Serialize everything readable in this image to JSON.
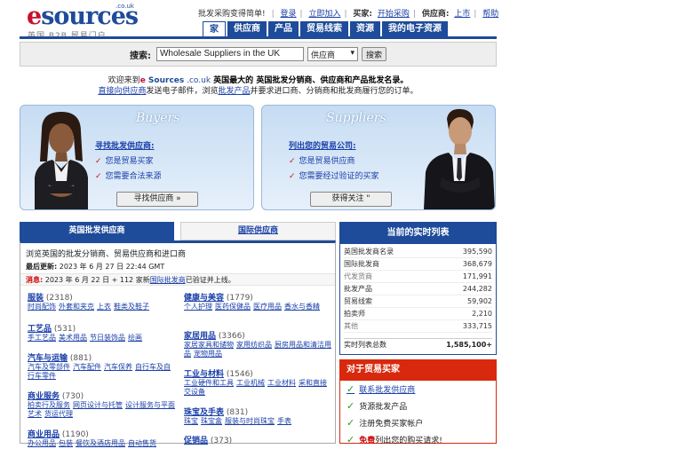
{
  "logo": {
    "main_e": "e",
    "main_rest": "sources",
    "couk": ".co.uk",
    "subtitle": "英国 B2B 贸易门户"
  },
  "toplinks": {
    "tagline": "批发采购变得简单!",
    "login": "登录",
    "join": "立即加入",
    "buyer_label": "买家:",
    "buyer_link": "开始采购",
    "supplier_label": "供应商:",
    "supplier_link": "上市",
    "help": "帮助"
  },
  "nav": [
    "家",
    "供应商",
    "产品",
    "贸易线索",
    "资源",
    "我的电子资源"
  ],
  "search": {
    "label": "搜索:",
    "value": "Wholesale Suppliers in the UK",
    "select": "供应商",
    "button": "搜索"
  },
  "welcome": {
    "line1_pre": "欢迎来到",
    "brand_e": "e",
    "brand_rest": " Sources",
    "brand_couk": " .co.uk",
    "line1_post": " 英国最大的 英国批发分销商、供应商和产品批发名录。",
    "line2_link": "直接向供应商",
    "line2_mid": "发送电子邮件，浏览",
    "line2_link2": "批发产品",
    "line2_post": "并要求进口商、分销商和批发商履行您的订单。"
  },
  "buyers": {
    "title": "Buyers",
    "heading": "寻找批发供应商:",
    "bullets": [
      "您是贸易买家",
      "您需要合法来源"
    ],
    "button": "寻找供应商 »"
  },
  "suppliers": {
    "title": "Suppliers",
    "heading": "列出您的贸易公司:",
    "bullets": [
      "您是贸易供应商",
      "您需要经过验证的买家"
    ],
    "button": "获得关注 \""
  },
  "tabs": {
    "uk": "英国批发供应商",
    "international": "国际供应商"
  },
  "listing": {
    "intro": "浏览英国的批发分销商、贸易供应商和进口商",
    "updated_label": "最后更新:",
    "updated_value": " 2023 年 6 月 27 日 22:44 GMT",
    "msg_label": "消息:",
    "msg_text": " 2023 年 6 月 22 日 + 112 家新",
    "msg_link": "国际批发商",
    "msg_post": "已验证并上线。"
  },
  "categories_left": [
    {
      "name": "服装",
      "count": "(2318)",
      "subs": [
        "时尚配饰",
        "外套和夹克",
        "上衣",
        "鞋类及鞋子"
      ]
    },
    {
      "name": "工艺品",
      "count": "(531)",
      "subs": [
        "手工艺品",
        "美术用品",
        "节日装饰品",
        "绘画"
      ]
    },
    {
      "name": "汽车与运输",
      "count": "(881)",
      "subs": [
        "汽车及零部件",
        "汽车配件",
        "汽车保养",
        "自行车及自行车零件"
      ]
    },
    {
      "name": "商业服务",
      "count": "(730)",
      "subs": [
        "拍卖行及服务",
        "网页设计与托管",
        "设计服务与平面艺术",
        "货运代理"
      ]
    },
    {
      "name": "商业用品",
      "count": "(1190)",
      "subs": [
        "办公用品",
        "包装",
        "餐饮及酒店用品",
        "自动售货"
      ]
    }
  ],
  "categories_right": [
    {
      "name": "健康与美容",
      "count": "(1779)",
      "subs": [
        "个人护理",
        "医药保健品",
        "医疗用品",
        "香水与香精"
      ]
    },
    {
      "name": "家居用品",
      "count": "(3366)",
      "subs": [
        "家居家具和储物",
        "家用纺织品",
        "厨房用品和清洁用品",
        "宠物用品"
      ]
    },
    {
      "name": "工业与材料",
      "count": "(1546)",
      "subs": [
        "工业硬件和工具",
        "工业机械",
        "工业材料",
        "采和直接交设备"
      ]
    },
    {
      "name": "珠宝及手表",
      "count": "(831)",
      "subs": [
        "珠宝",
        "珠宝盒",
        "服装与时尚珠宝",
        "手表"
      ]
    },
    {
      "name": "促销品",
      "count": "(373)",
      "subs": []
    }
  ],
  "realtime": {
    "title": "当前的实时列表",
    "rows": [
      {
        "label": "英国批发商名录",
        "value": "395,590",
        "grey": false
      },
      {
        "label": "国际批发商",
        "value": "368,679",
        "grey": false
      },
      {
        "label": "代发货商",
        "value": "171,991",
        "grey": true
      },
      {
        "label": "批发产品",
        "value": "244,282",
        "grey": false
      },
      {
        "label": "贸易线索",
        "value": "59,902",
        "grey": false
      },
      {
        "label": "拍卖师",
        "value": "2,210",
        "grey": false
      },
      {
        "label": "其他",
        "value": "333,715",
        "grey": true
      }
    ],
    "total_label": "实时列表总数",
    "total_value": "1,585,100+"
  },
  "trade_buyers": {
    "title": "对于贸易买家",
    "items": [
      {
        "text": "联系批发供应商",
        "link": true
      },
      {
        "text": "货源批发产品",
        "link": false
      },
      {
        "text": "注册免费买家帐户",
        "link": false
      }
    ],
    "last_red": "免费",
    "last_text": "列出您的购买请求!"
  },
  "colors": {
    "brand_blue": "#1e4b9a",
    "brand_red": "#c8102e",
    "buyer_red": "#d8290e",
    "check_green": "#2e9a1e"
  }
}
